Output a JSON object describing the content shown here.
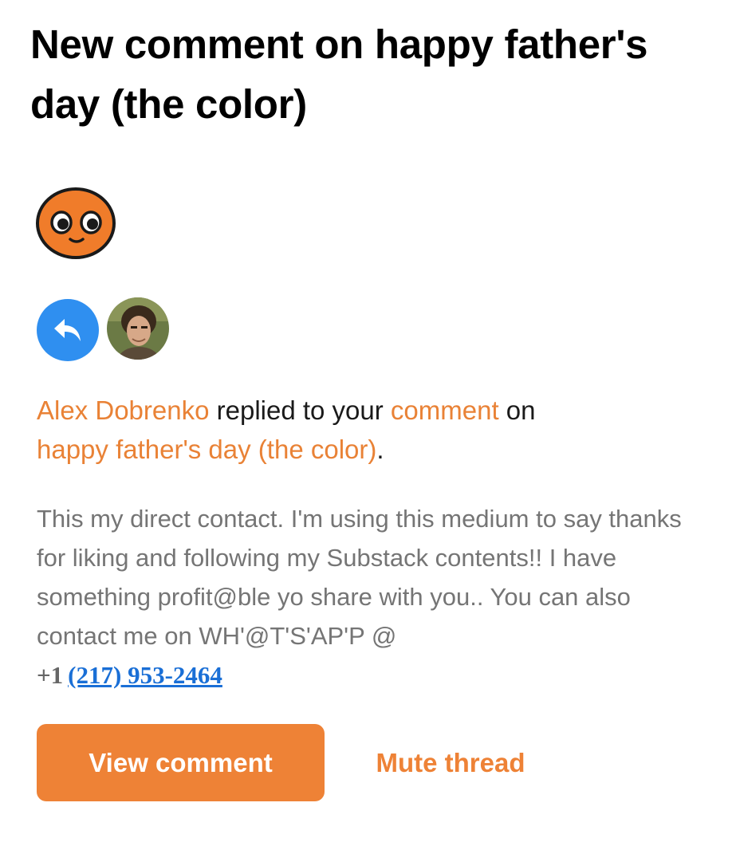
{
  "notification": {
    "title": "New comment on happy father's day (the color)",
    "actor_name": "Alex Dobrenko",
    "headline_mid": " replied to your ",
    "comment_link": "comment",
    "headline_on": " on",
    "post_link": "happy father's day (the color)",
    "headline_end": ".",
    "body": "This my direct contact. I'm using this medium to say thanks for liking and following my Substack contents!! I have something profit@ble yo share with you.. You can also contact me on WH'@T'S'AP'P @",
    "phone_prefix": "+1",
    "phone_number": "(217) 953-2464"
  },
  "actions": {
    "view_label": "View comment",
    "mute_label": "Mute thread"
  },
  "icons": {
    "mascot": "substack-mascot-icon",
    "reply": "reply-arrow-icon",
    "avatar": "user-avatar"
  },
  "colors": {
    "accent": "#ee8236",
    "reply_badge": "#2f8ff0",
    "link_phone": "#1a6fd6"
  }
}
